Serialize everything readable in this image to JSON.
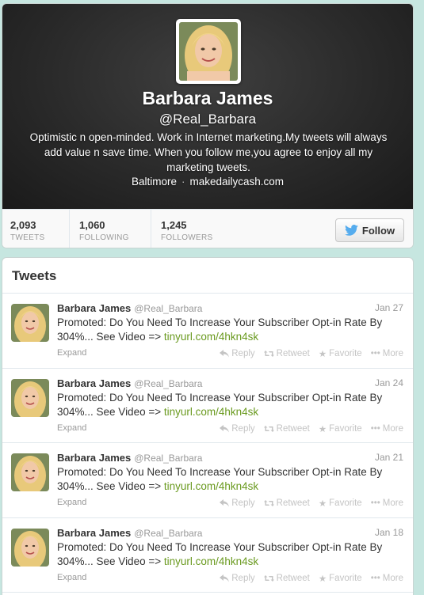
{
  "profile": {
    "name": "Barbara James",
    "handle": "@Real_Barbara",
    "bio": "Optimistic n open-minded. Work in Internet marketing.My tweets will always add value n save time. When you follow me,you agree to enjoy all my marketing tweets.",
    "location": "Baltimore",
    "separator": "·",
    "website": "makedailycash.com"
  },
  "stats": [
    {
      "num": "2,093",
      "label": "TWEETS"
    },
    {
      "num": "1,060",
      "label": "FOLLOWING"
    },
    {
      "num": "1,245",
      "label": "FOLLOWERS"
    }
  ],
  "follow_label": "Follow",
  "tweets_title": "Tweets",
  "actions": {
    "reply": "Reply",
    "retweet": "Retweet",
    "favorite": "Favorite",
    "more": "More",
    "expand": "Expand"
  },
  "tweets": [
    {
      "name": "Barbara James",
      "handle": "@Real_Barbara",
      "date": "Jan 27",
      "text": "Promoted: Do You Need To Increase Your Subscriber Opt-in Rate By 304%... See Video => ",
      "link": "tinyurl.com/4hkn4sk"
    },
    {
      "name": "Barbara James",
      "handle": "@Real_Barbara",
      "date": "Jan 24",
      "text": "Promoted: Do You Need To Increase Your Subscriber Opt-in Rate By 304%... See Video => ",
      "link": "tinyurl.com/4hkn4sk"
    },
    {
      "name": "Barbara James",
      "handle": "@Real_Barbara",
      "date": "Jan 21",
      "text": "Promoted: Do You Need To Increase Your Subscriber Opt-in Rate By 304%... See Video => ",
      "link": "tinyurl.com/4hkn4sk"
    },
    {
      "name": "Barbara James",
      "handle": "@Real_Barbara",
      "date": "Jan 18",
      "text": "Promoted: Do You Need To Increase Your Subscriber Opt-in Rate By 304%... See Video => ",
      "link": "tinyurl.com/4hkn4sk"
    }
  ],
  "colors": {
    "link": "#6a9a1f",
    "twitter_bird": "#55acee",
    "header_bg": "#2a2a2a"
  }
}
